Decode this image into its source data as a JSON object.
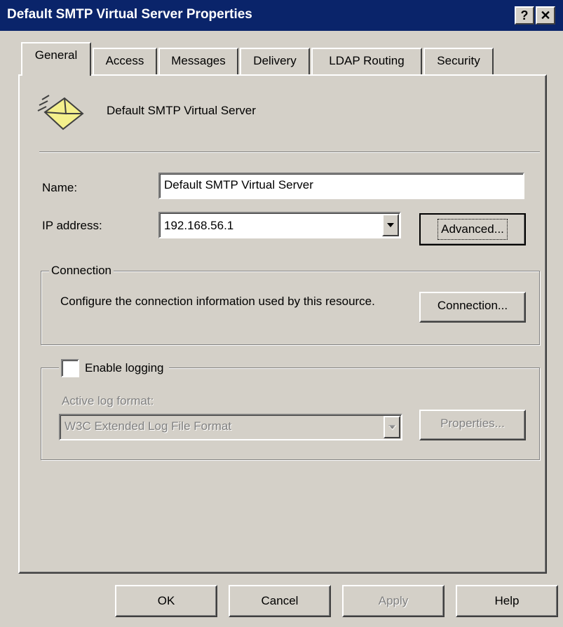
{
  "window": {
    "title": "Default SMTP Virtual Server Properties",
    "help_button": "?",
    "close_button": "✕"
  },
  "tabs": [
    {
      "label": "General",
      "active": true
    },
    {
      "label": "Access"
    },
    {
      "label": "Messages"
    },
    {
      "label": "Delivery"
    },
    {
      "label": "LDAP Routing"
    },
    {
      "label": "Security"
    }
  ],
  "general": {
    "header_text": "Default SMTP Virtual Server",
    "header_icon": "envelope-icon",
    "name_label": "Name:",
    "name_value": "Default SMTP Virtual Server",
    "ip_label": "IP address:",
    "ip_value": "192.168.56.1",
    "advanced_button": "Advanced...",
    "connection": {
      "group_label": "Connection",
      "description": "Configure the connection information used by this resource.",
      "button": "Connection..."
    },
    "logging": {
      "checkbox_label": "Enable logging",
      "checked": false,
      "format_label": "Active log format:",
      "format_value": "W3C Extended Log File Format",
      "properties_button": "Properties..."
    }
  },
  "footer": {
    "ok": "OK",
    "cancel": "Cancel",
    "apply": "Apply",
    "help": "Help"
  },
  "colors": {
    "titlebar": "#0a246a",
    "face": "#d4d0c8",
    "disabled_text": "#808080"
  }
}
